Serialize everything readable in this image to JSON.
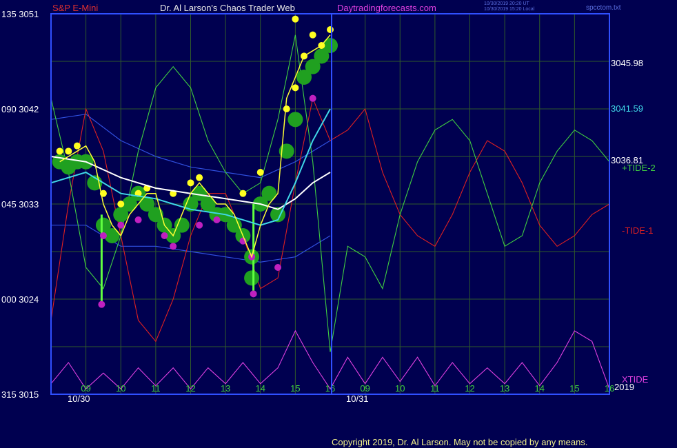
{
  "header": {
    "instrument": "S&P E-Mini",
    "title": "Dr. Al Larson's Chaos Trader Web",
    "site": "Daytradingforecasts.com",
    "timestamp_ut": "10/30/2019 20:20 UT",
    "timestamp_local": "10/30/2019 15:20 Local",
    "filename": "spcctom.txt"
  },
  "footer": {
    "copyright": "Copyright 2019, Dr. Al Larson. May not be copied by any means."
  },
  "colors": {
    "background": "#000050",
    "frame": "#3050ff",
    "grid": "#2f5a2a",
    "price": "#ffff33",
    "tide1": "#e02020",
    "tide2": "#40d040",
    "xtide": "#e040e0",
    "band": "#3050e0",
    "ma_white": "#ffffff",
    "ma_cyan": "#40d8e8",
    "dot_green": "#20a020",
    "dot_yellow": "#ffff20",
    "dot_magenta": "#c020c0",
    "instrument_text": "#e03030",
    "title_text": "#e8e8e8",
    "site_text": "#e040e0"
  },
  "chart_data": {
    "type": "line",
    "title": "S&P E-Mini",
    "ylabel_left_pairs": [
      [
        "135",
        "3051"
      ],
      [
        "090",
        "3042"
      ],
      [
        "045",
        "3033"
      ],
      [
        "000",
        "3024"
      ],
      [
        "315",
        "3015"
      ]
    ],
    "ylim": [
      3015,
      3051
    ],
    "x_hour_labels_day1": [
      "09",
      "10",
      "11",
      "12",
      "13",
      "14",
      "15",
      "16"
    ],
    "x_hour_labels_day2": [
      "09",
      "10",
      "11",
      "12",
      "13",
      "14",
      "15",
      "16"
    ],
    "x_date_labels": [
      "10/30",
      "10/31"
    ],
    "year_label": "2019",
    "right_labels": [
      {
        "text": "3045.98",
        "color": "#ffffff"
      },
      {
        "text": "3041.59",
        "color": "#40d8e8"
      },
      {
        "text": "3036.81",
        "color": "#ffffff"
      },
      {
        "text": "+TIDE-2",
        "color": "#40d040"
      },
      {
        "text": "-TIDE-1",
        "color": "#e02020"
      },
      {
        "text": "XTIDE",
        "color": "#e040e0"
      }
    ],
    "grid": true,
    "series": [
      {
        "name": "Price",
        "color": "#ffff33",
        "x": [
          8.25,
          8.5,
          8.75,
          9.0,
          9.25,
          9.5,
          9.75,
          10.0,
          10.25,
          10.5,
          10.75,
          11.0,
          11.25,
          11.5,
          11.75,
          12.0,
          12.25,
          12.5,
          12.75,
          13.0,
          13.25,
          13.5,
          13.75,
          14.0,
          14.25,
          14.5,
          14.75,
          15.0,
          15.25,
          15.5,
          15.75,
          16.0
        ],
        "y": [
          3037,
          3037.5,
          3038,
          3038.5,
          3037,
          3033,
          3031,
          3030,
          3032,
          3033,
          3034,
          3034,
          3031,
          3030,
          3032,
          3034,
          3035,
          3034,
          3033,
          3033,
          3032,
          3030,
          3028,
          3031,
          3033,
          3034,
          3043,
          3045,
          3047,
          3047.5,
          3048,
          3049
        ]
      },
      {
        "name": "+TIDE-2",
        "color": "#40d040",
        "x": [
          8.0,
          8.5,
          9.0,
          9.5,
          10.0,
          10.5,
          11.0,
          11.5,
          12.0,
          12.5,
          13.0,
          13.5,
          14.0,
          14.5,
          15.0,
          15.5,
          16.0,
          16.5,
          17.0,
          17.5,
          18.0,
          18.5,
          19.0,
          19.5,
          20.0,
          20.5,
          21.0,
          21.5,
          22.0,
          22.5,
          23.0,
          23.5,
          24.0
        ],
        "y": [
          3043,
          3036,
          3027,
          3025,
          3030,
          3038,
          3044,
          3046,
          3044,
          3039,
          3036,
          3034,
          3035,
          3041,
          3049,
          3037,
          3019,
          3029,
          3028,
          3025,
          3032,
          3037,
          3040,
          3041,
          3039,
          3034,
          3029,
          3030,
          3035,
          3038,
          3040,
          3039,
          3037
        ]
      },
      {
        "name": "-TIDE-1",
        "color": "#e02020",
        "x": [
          8.0,
          8.5,
          9.0,
          9.5,
          10.0,
          10.5,
          11.0,
          11.5,
          12.0,
          12.5,
          13.0,
          13.5,
          14.0,
          14.5,
          15.0,
          15.5,
          16.0,
          16.5,
          17.0,
          17.5,
          18.0,
          18.5,
          19.0,
          19.5,
          20.0,
          20.5,
          21.0,
          21.5,
          22.0,
          22.5,
          23.0,
          23.5,
          24.0
        ],
        "y": [
          3022,
          3033,
          3042,
          3038,
          3030,
          3022,
          3020,
          3024,
          3030,
          3034,
          3034,
          3030,
          3025,
          3026,
          3035,
          3043,
          3039,
          3040,
          3042,
          3036,
          3032,
          3030,
          3029,
          3032,
          3036,
          3039,
          3038,
          3035,
          3031,
          3029,
          3030,
          3032,
          3033
        ]
      },
      {
        "name": "XTIDE",
        "color": "#e040e0",
        "x": [
          8.0,
          8.5,
          9.0,
          9.5,
          10.0,
          10.5,
          11.0,
          11.5,
          12.0,
          12.5,
          13.0,
          13.5,
          14.0,
          14.5,
          15.0,
          15.5,
          16.0,
          16.5,
          17.0,
          17.5,
          18.0,
          18.5,
          19.0,
          19.5,
          20.0,
          20.5,
          21.0,
          21.5,
          22.0,
          22.5,
          23.0,
          23.5,
          24.0
        ],
        "y": [
          3016,
          3018,
          3015.5,
          3017,
          3015.5,
          3017.5,
          3015.8,
          3017.5,
          3015.5,
          3017.5,
          3016,
          3018,
          3016,
          3017.5,
          3021,
          3018,
          3015.5,
          3018.5,
          3016,
          3018.5,
          3016.2,
          3018.5,
          3015.8,
          3018,
          3016,
          3017.5,
          3016,
          3018,
          3015.8,
          3018,
          3021,
          3020,
          3015.5
        ]
      },
      {
        "name": "White MA",
        "color": "#ffffff",
        "x": [
          8.0,
          9.0,
          10.0,
          11.0,
          12.0,
          13.0,
          14.0,
          14.5,
          15.0,
          15.5,
          16.0
        ],
        "y": [
          3037.5,
          3037,
          3035.5,
          3034.5,
          3034,
          3033.5,
          3033,
          3032.5,
          3033.5,
          3035,
          3036
        ]
      },
      {
        "name": "Cyan MA",
        "color": "#40d8e8",
        "x": [
          8.0,
          9.0,
          10.0,
          11.0,
          12.0,
          13.0,
          14.0,
          14.5,
          15.0,
          15.5,
          16.0
        ],
        "y": [
          3035,
          3036,
          3034,
          3033.5,
          3032.5,
          3032,
          3031,
          3031.5,
          3035,
          3039,
          3042
        ]
      },
      {
        "name": "Upper Band",
        "color": "#3050e0",
        "x": [
          8.0,
          9.0,
          10.0,
          11.0,
          12.0,
          13.0,
          14.0,
          15.0,
          16.0
        ],
        "y": [
          3041,
          3041.5,
          3039,
          3037.5,
          3036.5,
          3036,
          3035.5,
          3037,
          3039
        ]
      },
      {
        "name": "Lower Band",
        "color": "#3050e0",
        "x": [
          8.0,
          9.0,
          10.0,
          11.0,
          12.0,
          13.0,
          14.0,
          15.0,
          16.0
        ],
        "y": [
          3031,
          3031,
          3029,
          3029,
          3028.5,
          3028,
          3027.5,
          3028,
          3030
        ]
      }
    ],
    "spikes": [
      {
        "x": 9.45,
        "y_top": 3032,
        "y_bottom": 3023.5
      },
      {
        "x": 13.8,
        "y_top": 3033,
        "y_bottom": 3024.5
      }
    ],
    "dots": {
      "yellow": [
        [
          8.25,
          3038
        ],
        [
          8.5,
          3038
        ],
        [
          8.75,
          3038.5
        ],
        [
          9.5,
          3034
        ],
        [
          10.0,
          3033
        ],
        [
          10.5,
          3034
        ],
        [
          10.75,
          3034.5
        ],
        [
          11.5,
          3034
        ],
        [
          12.0,
          3035
        ],
        [
          12.25,
          3035.5
        ],
        [
          13.5,
          3034
        ],
        [
          14.0,
          3036
        ],
        [
          14.75,
          3042
        ],
        [
          15.0,
          3044
        ],
        [
          15.25,
          3047
        ],
        [
          15.5,
          3049
        ],
        [
          15.75,
          3048
        ],
        [
          16.0,
          3049.5
        ],
        [
          15.0,
          3050.5
        ]
      ],
      "magenta": [
        [
          9.5,
          3030
        ],
        [
          10.0,
          3031
        ],
        [
          10.5,
          3031.5
        ],
        [
          11.25,
          3030
        ],
        [
          11.5,
          3029
        ],
        [
          12.25,
          3031
        ],
        [
          12.75,
          3031.5
        ],
        [
          13.5,
          3029.5
        ],
        [
          13.75,
          3028
        ],
        [
          14.5,
          3027
        ],
        [
          9.45,
          3023.5
        ],
        [
          13.8,
          3024.5
        ],
        [
          15.5,
          3043
        ]
      ],
      "green": [
        [
          8.25,
          3037
        ],
        [
          8.5,
          3036.5
        ],
        [
          8.75,
          3037
        ],
        [
          9.0,
          3037
        ],
        [
          9.25,
          3035
        ],
        [
          9.5,
          3031
        ],
        [
          9.75,
          3030
        ],
        [
          10.0,
          3032
        ],
        [
          10.25,
          3033
        ],
        [
          10.5,
          3034
        ],
        [
          10.75,
          3033
        ],
        [
          11.0,
          3032
        ],
        [
          11.25,
          3031
        ],
        [
          11.5,
          3030
        ],
        [
          11.75,
          3031
        ],
        [
          12.0,
          3033
        ],
        [
          12.25,
          3034
        ],
        [
          12.5,
          3033
        ],
        [
          12.75,
          3032
        ],
        [
          13.0,
          3032
        ],
        [
          13.25,
          3031
        ],
        [
          13.5,
          3030
        ],
        [
          13.75,
          3028
        ],
        [
          13.75,
          3026
        ],
        [
          14.0,
          3033
        ],
        [
          14.25,
          3034
        ],
        [
          14.5,
          3032
        ],
        [
          14.75,
          3038
        ],
        [
          15.0,
          3041
        ],
        [
          15.25,
          3045
        ],
        [
          15.5,
          3046
        ],
        [
          15.75,
          3047
        ],
        [
          16.0,
          3048
        ]
      ]
    }
  }
}
